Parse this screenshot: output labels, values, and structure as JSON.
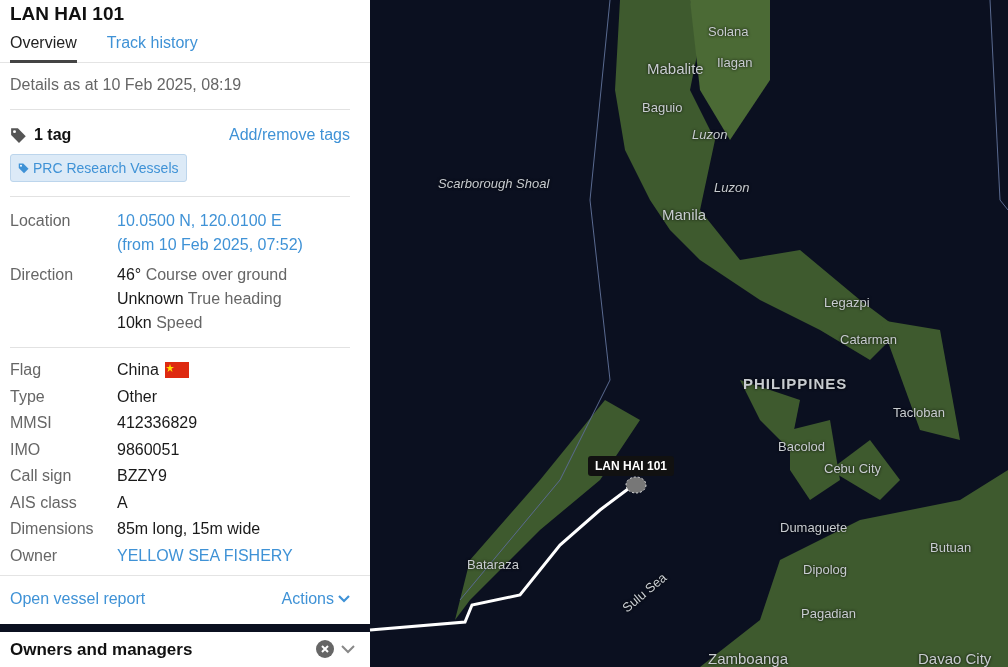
{
  "vessel_panel": {
    "title": "LAN HAI 101",
    "tabs": [
      {
        "label": "Overview",
        "selected": true
      },
      {
        "label": "Track history",
        "selected": false
      }
    ],
    "details_date": "Details as at 10 Feb 2025, 08:19",
    "tags": {
      "count_label": "1 tag",
      "action": "Add/remove tags",
      "items": [
        {
          "label": "PRC Research Vessels"
        }
      ]
    },
    "position": [
      {
        "label": "Location",
        "kind": "link",
        "lines": [
          "10.0500 N, 120.0100 E",
          "(from 10 Feb 2025, 07:52)"
        ]
      },
      {
        "label": "Direction",
        "kind": "readings",
        "readings": [
          {
            "value": "46°",
            "caption": "Course over ground"
          },
          {
            "value": "Unknown",
            "caption": "True heading"
          },
          {
            "value": "10kn",
            "caption": "Speed"
          }
        ]
      }
    ],
    "properties": [
      {
        "label": "Flag",
        "value": "China",
        "kind": "flag"
      },
      {
        "label": "Type",
        "value": "Other",
        "kind": "text"
      },
      {
        "label": "MMSI",
        "value": "412336829",
        "kind": "text"
      },
      {
        "label": "IMO",
        "value": "9860051",
        "kind": "text"
      },
      {
        "label": "Call sign",
        "value": "BZZY9",
        "kind": "text"
      },
      {
        "label": "AIS class",
        "value": "A",
        "kind": "text"
      },
      {
        "label": "Dimensions",
        "value": "85m long, 15m wide",
        "kind": "text"
      },
      {
        "label": "Owner",
        "value": "YELLOW SEA FISHERY",
        "kind": "link"
      }
    ],
    "footer": {
      "report_link": "Open vessel report",
      "actions": "Actions"
    }
  },
  "owners_panel": {
    "title": "Owners and managers"
  },
  "map": {
    "labels": [
      {
        "text": "Solana",
        "kind": "city"
      },
      {
        "text": "Mabalite",
        "kind": "capital"
      },
      {
        "text": "Ilagan",
        "kind": "city"
      },
      {
        "text": "Baguio",
        "kind": "city"
      },
      {
        "text": "Luzon",
        "kind": "region"
      },
      {
        "text": "Scarborough Shoal",
        "kind": "region"
      },
      {
        "text": "Luzon",
        "kind": "region"
      },
      {
        "text": "Manila",
        "kind": "capital"
      },
      {
        "text": "Legazpi",
        "kind": "city"
      },
      {
        "text": "Catarman",
        "kind": "city"
      },
      {
        "text": "PHILIPPINES",
        "kind": "country"
      },
      {
        "text": "Tacloban",
        "kind": "city"
      },
      {
        "text": "Bacolod",
        "kind": "city"
      },
      {
        "text": "Cebu City",
        "kind": "city"
      },
      {
        "text": "Dumaguete",
        "kind": "city"
      },
      {
        "text": "Butuan",
        "kind": "city"
      },
      {
        "text": "Dipolog",
        "kind": "city"
      },
      {
        "text": "Pagadian",
        "kind": "city"
      },
      {
        "text": "Bataraza",
        "kind": "city"
      },
      {
        "text": "Sulu Sea",
        "kind": "water"
      },
      {
        "text": "Zamboanga",
        "kind": "capital"
      },
      {
        "text": "Davao City",
        "kind": "capital"
      }
    ],
    "vessel_marker": {
      "label": "LAN HAI 101"
    }
  }
}
